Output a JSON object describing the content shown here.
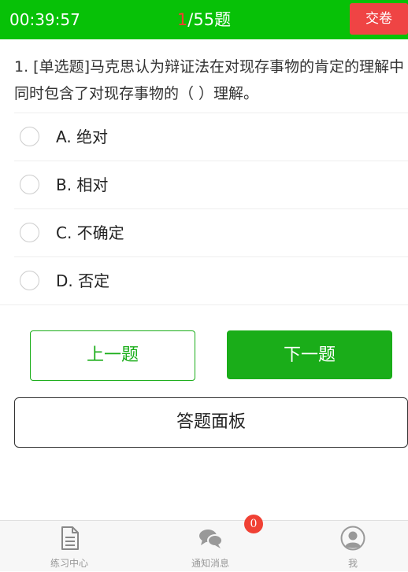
{
  "header": {
    "timer": "00:39:57",
    "progress_current": "1",
    "progress_total": "/55题",
    "submit_label": "交卷",
    "bar_color": "#07c107",
    "submit_color": "#ef4444"
  },
  "question": {
    "text": "1. [单选题]马克思认为辩证法在对现存事物的肯定的理解中同时包含了对现存事物的（ ）理解。"
  },
  "options": [
    {
      "label": "A. 绝对",
      "selected": false
    },
    {
      "label": "B. 相对",
      "selected": false
    },
    {
      "label": "C. 不确定",
      "selected": false
    },
    {
      "label": "D. 否定",
      "selected": false
    }
  ],
  "nav": {
    "prev_label": "上一题",
    "next_label": "下一题",
    "panel_label": "答题面板",
    "accent": "#1aad19"
  },
  "tabbar": {
    "items": [
      {
        "label": "练习中心",
        "icon": "document-icon"
      },
      {
        "label": "通知消息",
        "icon": "chat-bubbles-icon",
        "badge": "0"
      },
      {
        "label": "我",
        "icon": "user-avatar-icon"
      }
    ]
  }
}
